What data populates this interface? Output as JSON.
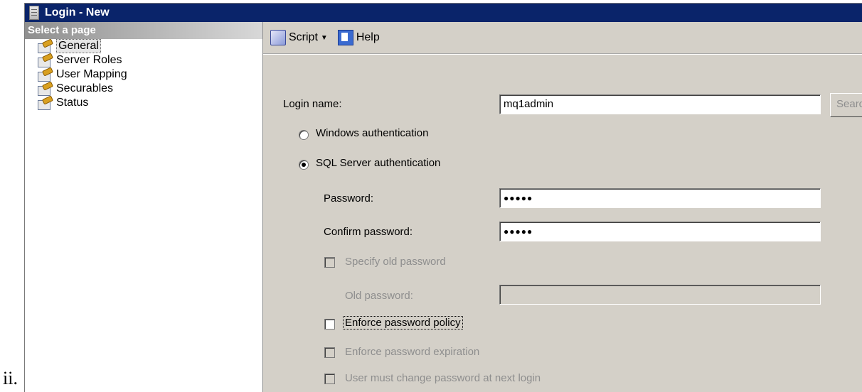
{
  "caption": "ii.",
  "window": {
    "title": "Login - New"
  },
  "sidebar": {
    "header": "Select a page",
    "items": [
      {
        "label": "General",
        "icon": "page-icon",
        "selected": true
      },
      {
        "label": "Server Roles",
        "icon": "page-icon"
      },
      {
        "label": "User Mapping",
        "icon": "page-icon"
      },
      {
        "label": "Securables",
        "icon": "page-icon"
      },
      {
        "label": "Status",
        "icon": "page-icon"
      }
    ]
  },
  "toolbar": {
    "script_label": "Script",
    "help_label": "Help"
  },
  "form": {
    "login_name_label": "Login name:",
    "login_name_value": "mq1admin",
    "search_button_label": "Search...",
    "windows_auth_label": "Windows authentication",
    "sql_auth_label": "SQL Server authentication",
    "password_label": "Password:",
    "password_value": "●●●●●",
    "confirm_password_label": "Confirm password:",
    "confirm_password_value": "●●●●●",
    "specify_old_password_label": "Specify old password",
    "old_password_label": "Old password:",
    "enforce_policy_label": "Enforce password policy",
    "enforce_expiration_label": "Enforce password expiration",
    "must_change_label": "User must change password at next login"
  },
  "colors": {
    "titlebar": "#0a246a",
    "dialog": "#d4d0c8",
    "disabled_text": "#8e8e8e"
  }
}
